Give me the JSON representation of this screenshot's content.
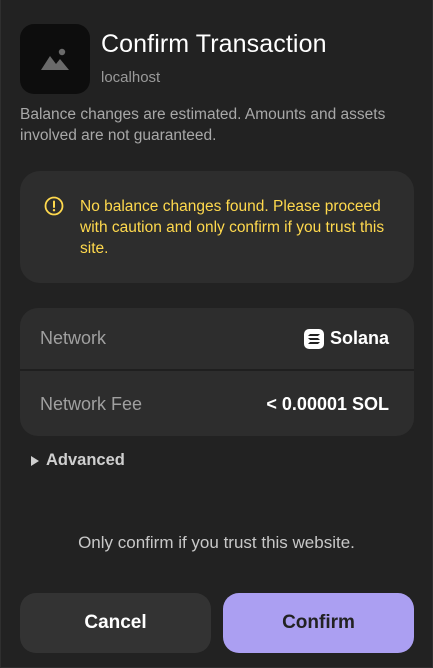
{
  "header": {
    "title": "Confirm Transaction",
    "origin": "localhost",
    "app_icon": "image-placeholder-icon"
  },
  "notice": "Balance changes are estimated. Amounts and assets involved are not guaranteed.",
  "warning": {
    "icon": "alert-circle-icon",
    "text": "No balance changes found. Please proceed with caution and only confirm if you trust this site.",
    "color": "#ffd94d"
  },
  "details": {
    "network": {
      "label": "Network",
      "value": "Solana",
      "icon": "solana-icon"
    },
    "fee": {
      "label": "Network Fee",
      "value": "< 0.00001 SOL"
    }
  },
  "advanced": {
    "label": "Advanced",
    "icon": "caret-right-icon"
  },
  "trust_note": "Only confirm if you trust this website.",
  "buttons": {
    "cancel": "Cancel",
    "confirm": "Confirm"
  },
  "colors": {
    "background": "#222222",
    "card": "#2d2d2d",
    "accent": "#ab9ff2"
  }
}
